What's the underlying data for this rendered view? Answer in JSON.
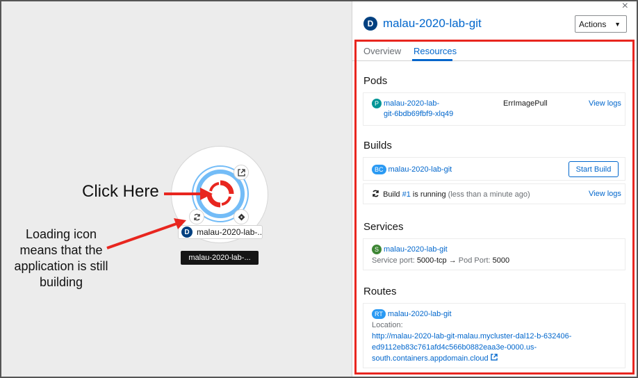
{
  "annotations": {
    "click_here": "Click Here",
    "loading_note": "Loading icon means that the application is still building"
  },
  "topology": {
    "node_label": "malau-2020-lab-...",
    "node_badge": "D",
    "tooltip": "malau-2020-lab-..."
  },
  "panel": {
    "badge": "D",
    "title": "malau-2020-lab-git",
    "actions_label": "Actions",
    "close_glyph": "×",
    "tabs": [
      "Overview",
      "Resources"
    ],
    "active_tab": "Resources",
    "pods": {
      "heading": "Pods",
      "badge": "P",
      "name_line1": "malau-2020-lab-",
      "name_line2": "git-6bdb69fbf9-xlq49",
      "status": "ErrImagePull",
      "logs_link": "View logs"
    },
    "builds": {
      "heading": "Builds",
      "badge": "BC",
      "name": "malau-2020-lab-git",
      "start_build": "Start Build",
      "build_word": "Build",
      "build_number": "#1",
      "running_text": "is running",
      "elapsed": "(less than a minute ago)",
      "logs_link": "View logs"
    },
    "services": {
      "heading": "Services",
      "badge": "S",
      "name": "malau-2020-lab-git",
      "service_port_label": "Service port:",
      "service_port": "5000-tcp",
      "arrow": "→",
      "pod_port_label": "Pod Port:",
      "pod_port": "5000"
    },
    "routes": {
      "heading": "Routes",
      "badge": "RT",
      "name": "malau-2020-lab-git",
      "location_label": "Location:",
      "url_line1": "http://malau-2020-lab-git-malau.mycluster-dal12-b-632406-",
      "url_line2": "ed9112eb83c761afd4c566b0882eaa3e-0000.us-",
      "url_line3": "south.containers.appdomain.cloud"
    }
  },
  "colors": {
    "accent": "#0066cc",
    "annotation_red": "#e8261f",
    "pod_badge": "#009596",
    "build_badge": "#2b9af3",
    "service_badge": "#3e8635",
    "route_badge": "#2b9af3",
    "dark_badge": "#004080"
  },
  "icons": [
    "refresh-icon",
    "external-link-icon",
    "git-icon",
    "openshift-logo",
    "sync-icon"
  ]
}
